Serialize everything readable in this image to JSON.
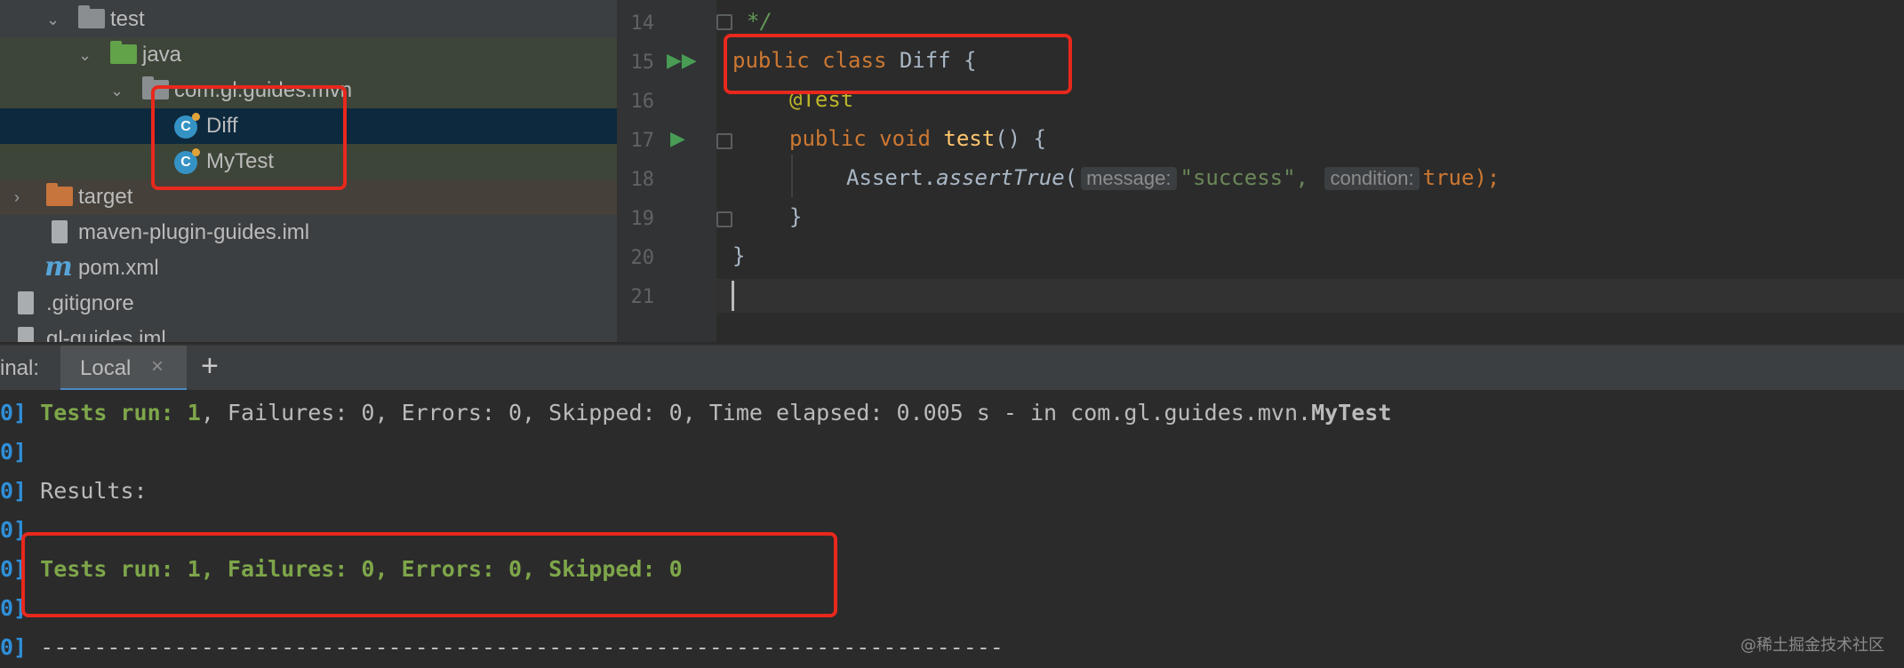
{
  "project_tree": {
    "items": [
      {
        "label": "test",
        "expanded": true,
        "icon": "folder-icon"
      },
      {
        "label": "java",
        "expanded": true,
        "icon": "test-source-folder-icon"
      },
      {
        "label": "com.gl.guides.mvn",
        "expanded": true,
        "icon": "package-icon"
      },
      {
        "label": "Diff",
        "icon": "java-class-icon",
        "selected": true
      },
      {
        "label": "MyTest",
        "icon": "java-class-icon"
      },
      {
        "label": "target",
        "expanded": false,
        "icon": "excluded-folder-icon"
      },
      {
        "label": "maven-plugin-guides.iml",
        "icon": "iml-file-icon"
      },
      {
        "label": "pom.xml",
        "icon": "maven-icon"
      },
      {
        "label": ".gitignore",
        "icon": "gitignore-file-icon"
      },
      {
        "label": "gl-guides.iml",
        "icon": "iml-file-icon"
      }
    ]
  },
  "editor": {
    "line_numbers": [
      "14",
      "15",
      "16",
      "17",
      "18",
      "19",
      "20",
      "21"
    ],
    "lines": {
      "l14": "*/",
      "l15_kw1": "public",
      "l15_kw2": "class",
      "l15_name": "Diff {",
      "l16": "@Test",
      "l17_kw1": "public",
      "l17_kw2": "void",
      "l17_fn": "test",
      "l17_rest": "() {",
      "l18_obj": "Assert.",
      "l18_method": "assertTrue",
      "l18_open": "(",
      "l18_hint1": "message:",
      "l18_str": "\"success\",",
      "l18_hint2": "condition:",
      "l18_true": "true",
      "l18_close": ");",
      "l19": "}",
      "l20": "}"
    }
  },
  "terminal": {
    "label": "inal:",
    "tab_local": "Local",
    "close_glyph": "×",
    "add_glyph": "+",
    "lines": [
      {
        "prefix": "0]",
        "p1": "Tests run: ",
        "p2": "1",
        "p3": ", Failures: 0, Errors: 0, Skipped: 0, Time elapsed: 0.005 s - in com.gl.guides.mvn.",
        "p4": "MyTest"
      },
      {
        "prefix": "0]"
      },
      {
        "prefix": "0]",
        "text": " Results:"
      },
      {
        "prefix": "0]"
      },
      {
        "prefix": "0]",
        "green": "Tests run: 1, Failures: 0, Errors: 0, Skipped: 0"
      },
      {
        "prefix": "0]"
      },
      {
        "prefix": "0]",
        "text": " ------------------------------------------------------------------------"
      }
    ]
  },
  "watermark": "@稀土掘金技术社区",
  "colors": {
    "highlight_box": "#e8281d",
    "selection": "#0d293e",
    "green_bg": "#3f4a3a"
  }
}
